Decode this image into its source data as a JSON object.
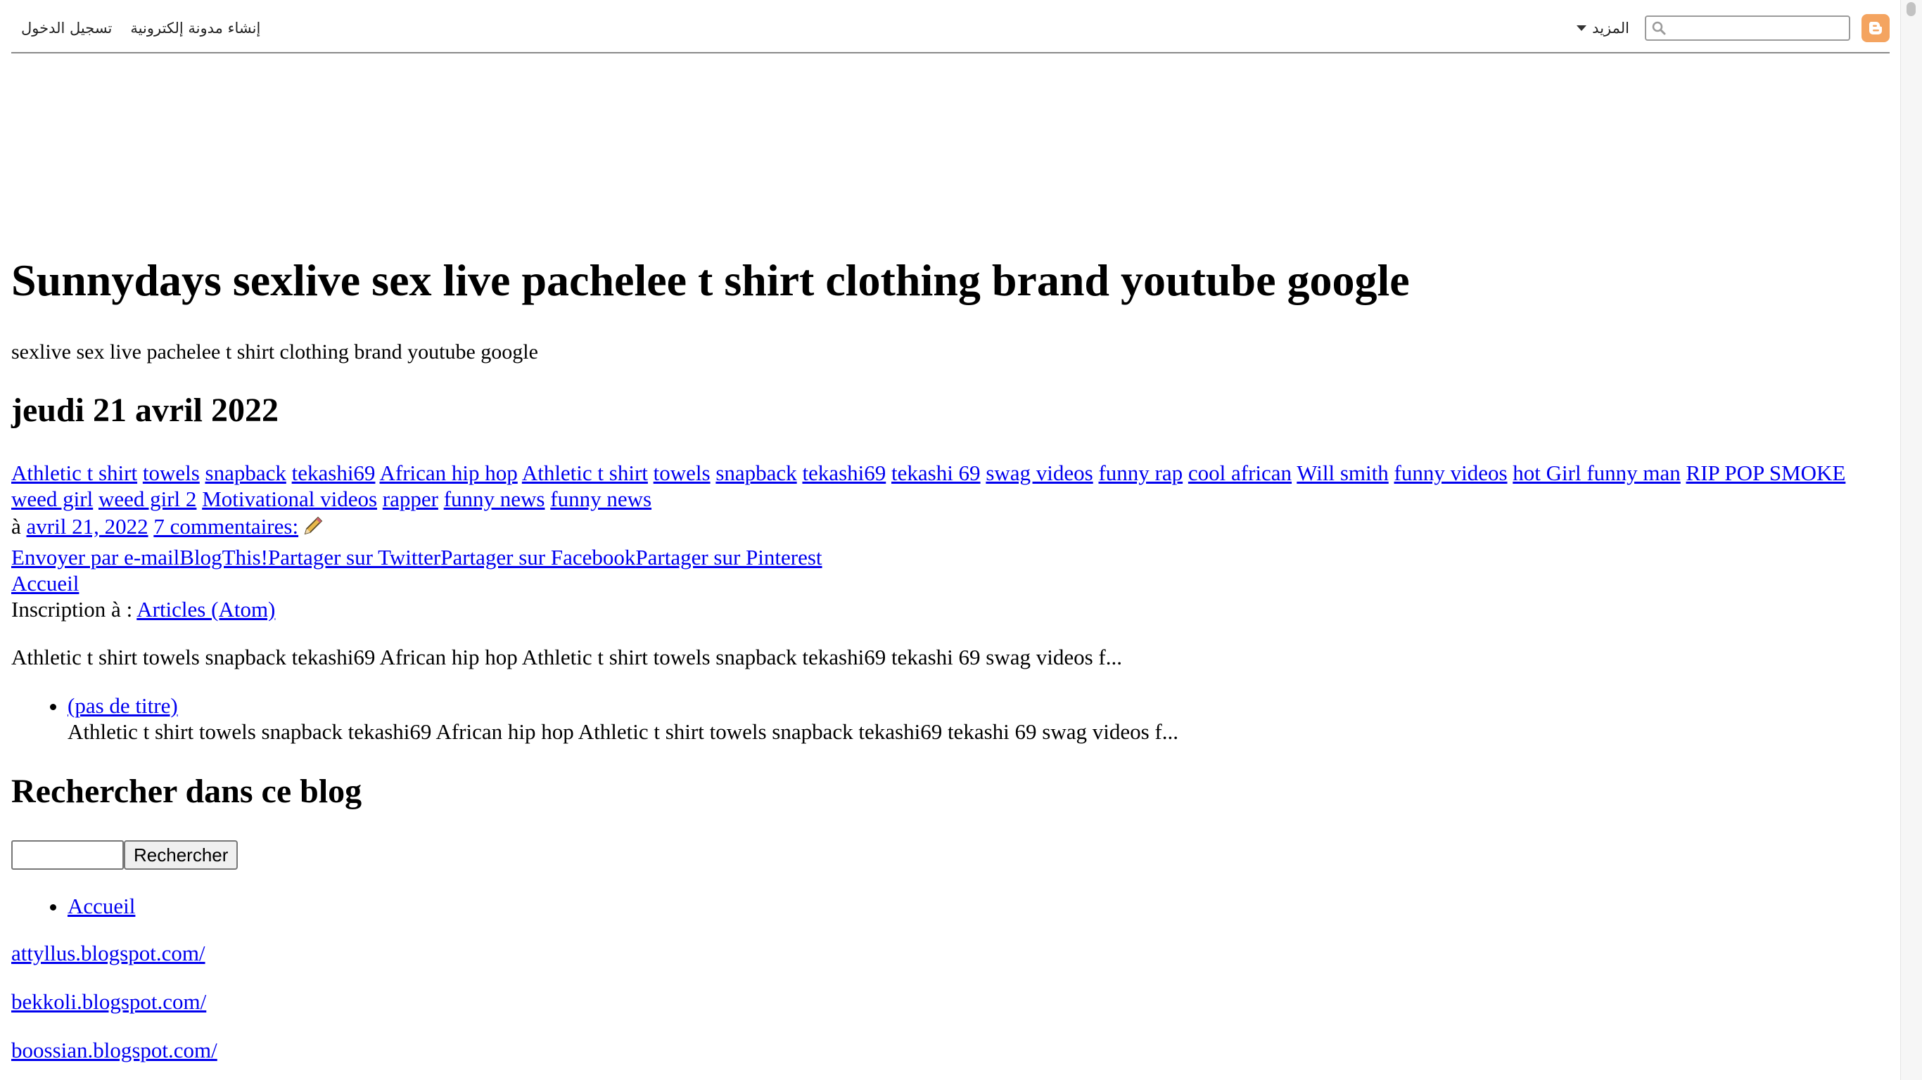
{
  "navbar": {
    "sign_in": "تسجيل الدخول",
    "create_blog": "إنشاء مدونة إلكترونية",
    "more": "المزيد",
    "search_placeholder": "",
    "blogger_color": "#f4a460"
  },
  "header": {
    "title": "Sunnydays sexlive sex live pachelee t shirt clothing brand youtube google",
    "description": "sexlive sex live pachelee t shirt clothing brand youtube google"
  },
  "post": {
    "date": "jeudi 21 avril 2022",
    "tags": [
      "Athletic t shirt",
      "towels",
      "snapback",
      "tekashi69",
      "African hip hop",
      "Athletic t shirt",
      "towels",
      "snapback",
      "tekashi69",
      "tekashi 69",
      "swag videos",
      "funny rap",
      "cool african",
      "Will smith",
      "funny videos",
      "hot Girl funny man",
      "RIP POP SMOKE",
      "weed girl",
      "weed girl 2",
      "Motivational videos",
      "rapper",
      "funny news",
      "funny news"
    ],
    "posted_prefix": "à",
    "timestamp": "avril 21, 2022",
    "comments": "7 commentaires:",
    "share": {
      "email": "Envoyer par e-mail",
      "blogthis": "BlogThis!",
      "twitter": "Partager sur Twitter",
      "facebook": "Partager sur Facebook",
      "pinterest": "Partager sur Pinterest"
    }
  },
  "home_link": "Accueil",
  "subscribe": {
    "prefix": "Inscription à :",
    "link": "Articles (Atom)"
  },
  "snippet": "Athletic t shirt towels snapback tekashi69 African hip hop Athletic t shirt towels snapback tekashi69 tekashi 69 swag videos f...",
  "popular_posts": [
    {
      "title": "(pas de titre)",
      "snippet": "Athletic t shirt towels snapback tekashi69 African hip hop Athletic t shirt towels snapback tekashi69 tekashi 69 swag videos f..."
    }
  ],
  "search_widget": {
    "heading": "Rechercher dans ce blog",
    "button": "Rechercher",
    "value": ""
  },
  "pages": [
    "Accueil"
  ],
  "blog_links": [
    "attyllus.blogspot.com/",
    "bekkoli.blogspot.com/",
    "boossian.blogspot.com/"
  ]
}
